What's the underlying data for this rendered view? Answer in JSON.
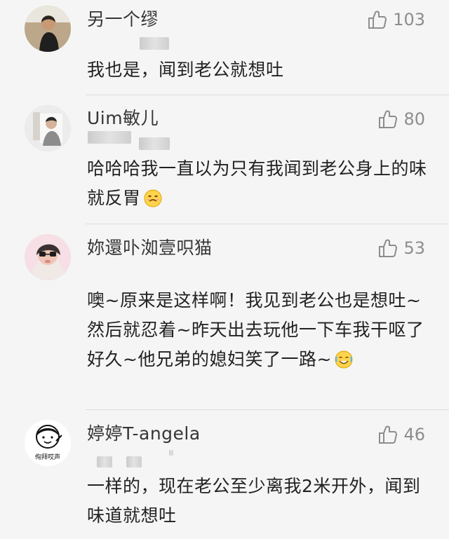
{
  "comments": [
    {
      "user": "另一个缪",
      "likes": "103",
      "text": "我也是，闻到老公就想吐"
    },
    {
      "user": "Uim敏儿",
      "likes": "80",
      "text": "哈哈哈我一直以为只有我闻到老公身上的味就反胃"
    },
    {
      "user": "妳還卟洳壹呮猫",
      "likes": "53",
      "text": "噢~原来是这样啊！我见到老公也是想吐~然后就忍着~昨天出去玩他一下车我干呕了好久~他兄弟的媳妇笑了一路~"
    },
    {
      "user": "婷婷T-angela",
      "likes": "46",
      "text": "一样的，现在老公至少离我2米开外，闻到味道就想吐"
    }
  ],
  "colors": {
    "background": "#f5f5f5",
    "text": "#222222",
    "muted": "#8d8d8d",
    "divider": "#dcdcdc"
  },
  "icons": {
    "like": "thumbs-up-icon",
    "emoji_1": "embarrassed-emoji",
    "emoji_2": "laughing-crying-emoji"
  }
}
